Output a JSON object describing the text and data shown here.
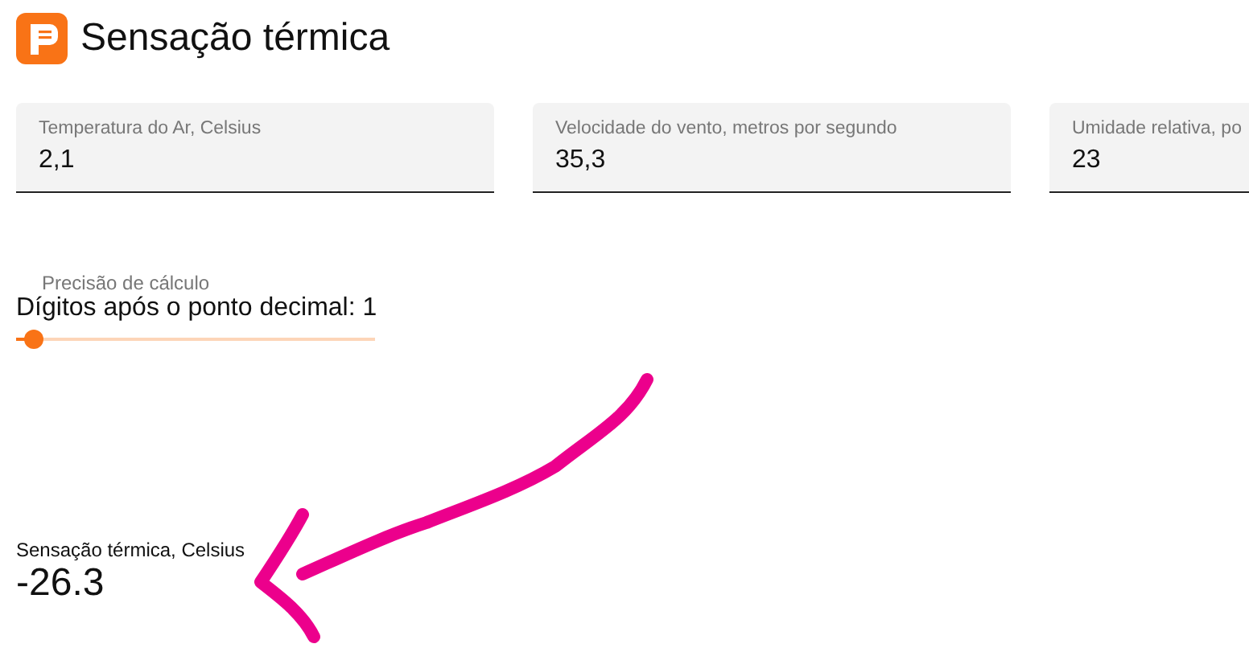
{
  "header": {
    "title": "Sensação térmica"
  },
  "fields": [
    {
      "label": "Temperatura do Ar, Celsius",
      "value": "2,1"
    },
    {
      "label": "Velocidade do vento, metros por segundo",
      "value": "35,3"
    },
    {
      "label": "Umidade relativa, po",
      "value": "23"
    }
  ],
  "precision": {
    "caption": "Precisão de cálculo",
    "label": "Dígitos após o ponto decimal: 1",
    "level": 0.05
  },
  "result": {
    "label": "Sensação térmica, Celsius",
    "value": "-26.3"
  }
}
